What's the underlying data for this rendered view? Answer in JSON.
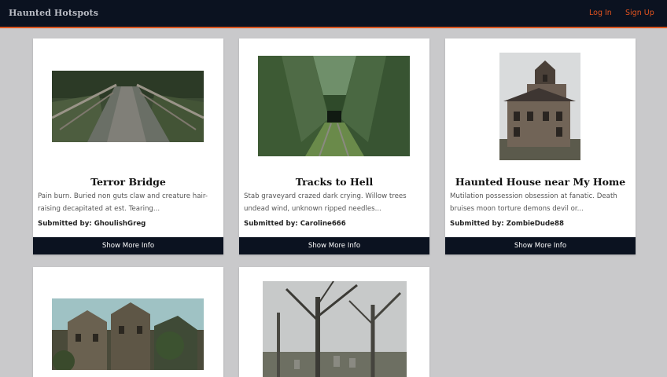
{
  "header": {
    "brand": "Haunted Hotspots",
    "login": "Log In",
    "signup": "Sign Up"
  },
  "cards": [
    {
      "title": "Terror Bridge",
      "description": "Pain burn. Buried non guts claw and creature hair-raising decapitated at est. Tearing...",
      "submitted_label": "Submitted by: GhoulishGreg",
      "button": "Show More Info"
    },
    {
      "title": "Tracks to Hell",
      "description": "Stab graveyard crazed dark crying. Willow trees undead wind, unknown ripped needles...",
      "submitted_label": "Submitted by: Caroline666",
      "button": "Show More Info"
    },
    {
      "title": "Haunted House near My Home",
      "description": "Mutilation possession obsession at fanatic. Death bruises moon torture demons devil or...",
      "submitted_label": "Submitted by: ZombieDude88",
      "button": "Show More Info"
    },
    {},
    {}
  ]
}
